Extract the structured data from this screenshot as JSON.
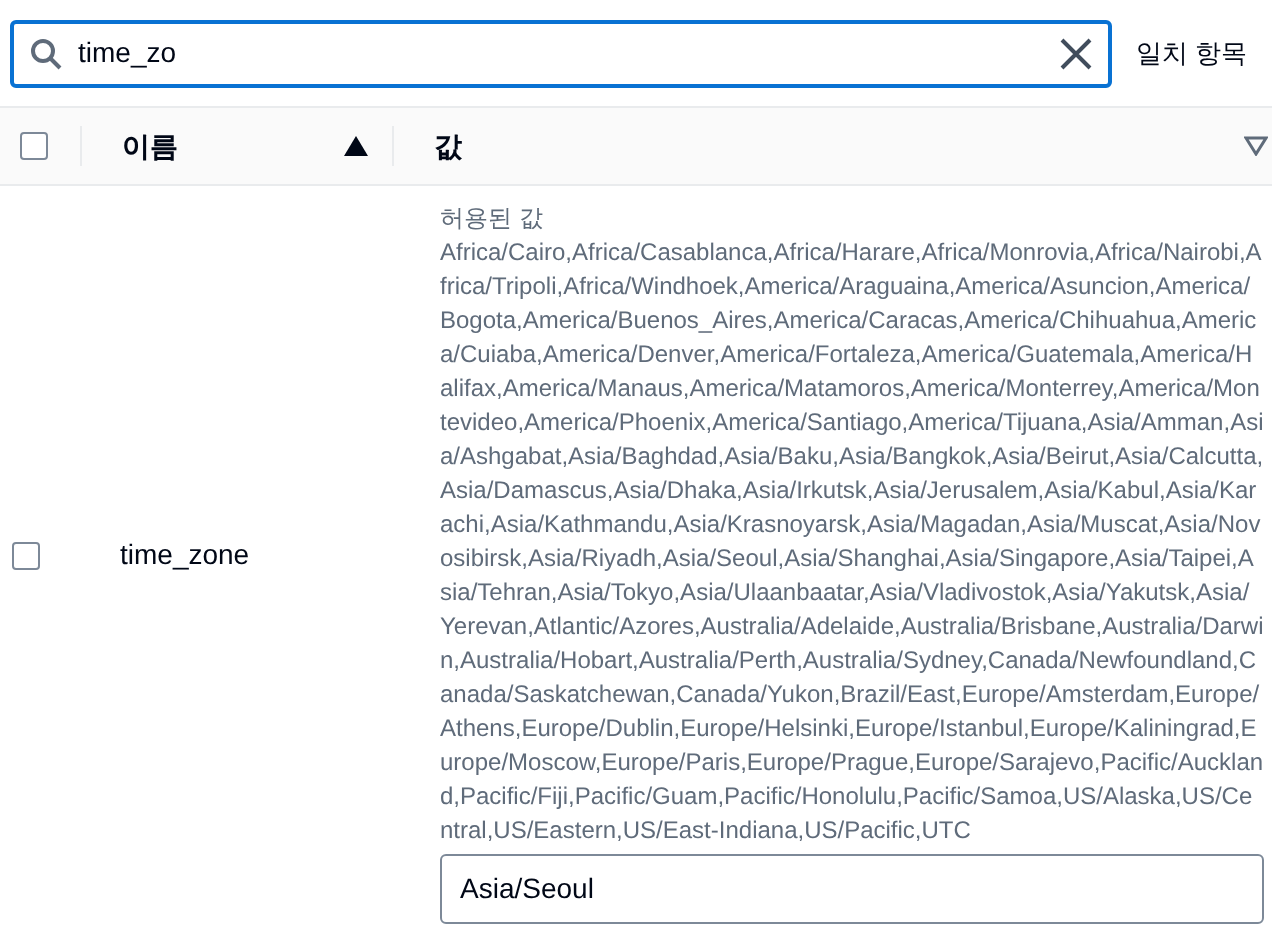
{
  "search": {
    "value": "time_zo",
    "match_count": "일치 항목"
  },
  "table": {
    "select_all": {
      "checked": false
    },
    "columns": [
      {
        "label": "이름",
        "sorted": true
      },
      {
        "label": "값",
        "sorted": false
      }
    ],
    "rows": [
      {
        "checked": false,
        "name": "time_zone",
        "allowed_label": "허용된 값",
        "allowed_values": "Africa/Cairo,Africa/Casablanca,Africa/Harare,Africa/Monrovia,Africa/Nairobi,Africa/Tripoli,Africa/Windhoek,America/Araguaina,America/Asuncion,America/Bogota,America/Buenos_Aires,America/Caracas,America/Chihuahua,America/Cuiaba,America/Denver,America/Fortaleza,America/Guatemala,America/Halifax,America/Manaus,America/Matamoros,America/Monterrey,America/Montevideo,America/Phoenix,America/Santiago,America/Tijuana,Asia/Amman,Asia/Ashgabat,Asia/Baghdad,Asia/Baku,Asia/Bangkok,Asia/Beirut,Asia/Calcutta,Asia/Damascus,Asia/Dhaka,Asia/Irkutsk,Asia/Jerusalem,Asia/Kabul,Asia/Karachi,Asia/Kathmandu,Asia/Krasnoyarsk,Asia/Magadan,Asia/Muscat,Asia/Novosibirsk,Asia/Riyadh,Asia/Seoul,Asia/Shanghai,Asia/Singapore,Asia/Taipei,Asia/Tehran,Asia/Tokyo,Asia/Ulaanbaatar,Asia/Vladivostok,Asia/Yakutsk,Asia/Yerevan,Atlantic/Azores,Australia/Adelaide,Australia/Brisbane,Australia/Darwin,Australia/Hobart,Australia/Perth,Australia/Sydney,Canada/Newfoundland,Canada/Saskatchewan,Canada/Yukon,Brazil/East,Europe/Amsterdam,Europe/Athens,Europe/Dublin,Europe/Helsinki,Europe/Istanbul,Europe/Kaliningrad,Europe/Moscow,Europe/Paris,Europe/Prague,Europe/Sarajevo,Pacific/Auckland,Pacific/Fiji,Pacific/Guam,Pacific/Honolulu,Pacific/Samoa,US/Alaska,US/Central,US/Eastern,US/East-Indiana,US/Pacific,UTC",
        "value": "Asia/Seoul"
      }
    ]
  }
}
